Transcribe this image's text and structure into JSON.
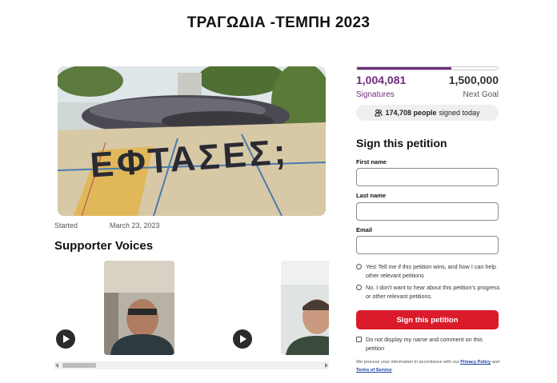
{
  "page": {
    "title": "ΤΡΑΓΩΔΙΑ -ΤΕΜΠΗ 2023"
  },
  "petition": {
    "started_label": "Started",
    "started_date": "March 23, 2023",
    "hero_text": "ΕΦΤΑΣΕΣ;"
  },
  "supporter_voices": {
    "title": "Supporter Voices",
    "cards": [
      {
        "label": "supporter-video-1"
      },
      {
        "label": "supporter-video-2"
      }
    ]
  },
  "stats": {
    "signatures": "1,004,081",
    "signatures_label": "Signatures",
    "goal": "1,500,000",
    "goal_label": "Next Goal",
    "progress_fraction": 0.67,
    "today_count": "174,708 people",
    "today_suffix": "signed today"
  },
  "form": {
    "heading": "Sign this petition",
    "first_name_label": "First name",
    "last_name_label": "Last name",
    "email_label": "Email",
    "first_name_value": "",
    "last_name_value": "",
    "email_value": "",
    "option_yes": "Yes! Tell me if this petition wins, and how I can help other relevant petitions",
    "option_no": "No. I don't want to hear about this petition's progress or other relevant petitions.",
    "submit_label": "Sign this petition",
    "hide_name_label": "Do not display my name and comment on this petition",
    "privacy_text": "We process your information in accordance with our",
    "privacy_link": "Privacy Policy",
    "and_text": "and",
    "terms_link": "Terms of Service",
    "period": "."
  },
  "colors": {
    "accent_purple": "#6e2c7d",
    "sign_red": "#da1b2b"
  }
}
